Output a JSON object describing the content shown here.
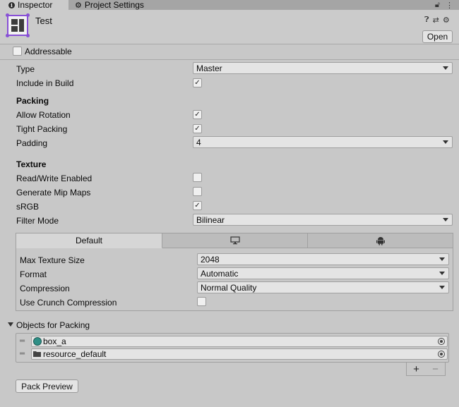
{
  "tabs": [
    {
      "label": "Inspector",
      "icon": "info-icon"
    },
    {
      "label": "Project Settings",
      "icon": "gear-icon"
    }
  ],
  "header": {
    "title": "Test",
    "open_label": "Open",
    "icons": [
      "help-icon",
      "presets-icon",
      "gear-icon"
    ],
    "asset_icon": "sprite-atlas-icon"
  },
  "addressable": {
    "label": "Addressable",
    "checked": false
  },
  "fields": {
    "type": {
      "label": "Type",
      "value": "Master"
    },
    "include_in_build": {
      "label": "Include in Build",
      "checked": true
    }
  },
  "packing": {
    "title": "Packing",
    "allow_rotation": {
      "label": "Allow Rotation",
      "checked": true
    },
    "tight_packing": {
      "label": "Tight Packing",
      "checked": true
    },
    "padding": {
      "label": "Padding",
      "value": "4"
    }
  },
  "texture": {
    "title": "Texture",
    "read_write": {
      "label": "Read/Write Enabled",
      "checked": false
    },
    "mip_maps": {
      "label": "Generate Mip Maps",
      "checked": false
    },
    "srgb": {
      "label": "sRGB",
      "checked": true
    },
    "filter_mode": {
      "label": "Filter Mode",
      "value": "Bilinear"
    }
  },
  "platform": {
    "tabs": [
      {
        "label": "Default"
      },
      {
        "icon": "monitor-icon"
      },
      {
        "icon": "android-icon"
      }
    ],
    "max_size": {
      "label": "Max Texture Size",
      "value": "2048"
    },
    "format": {
      "label": "Format",
      "value": "Automatic"
    },
    "compression": {
      "label": "Compression",
      "value": "Normal Quality"
    },
    "crunch": {
      "label": "Use Crunch Compression",
      "checked": false
    }
  },
  "objects": {
    "title": "Objects for Packing",
    "items": [
      {
        "name": "box_a",
        "icon": "sprite-icon"
      },
      {
        "name": "resource_default",
        "icon": "folder-icon"
      }
    ]
  },
  "pack_preview_label": "Pack Preview",
  "colors": {
    "accent": "#8850d6",
    "panel": "#c8c8c8"
  }
}
